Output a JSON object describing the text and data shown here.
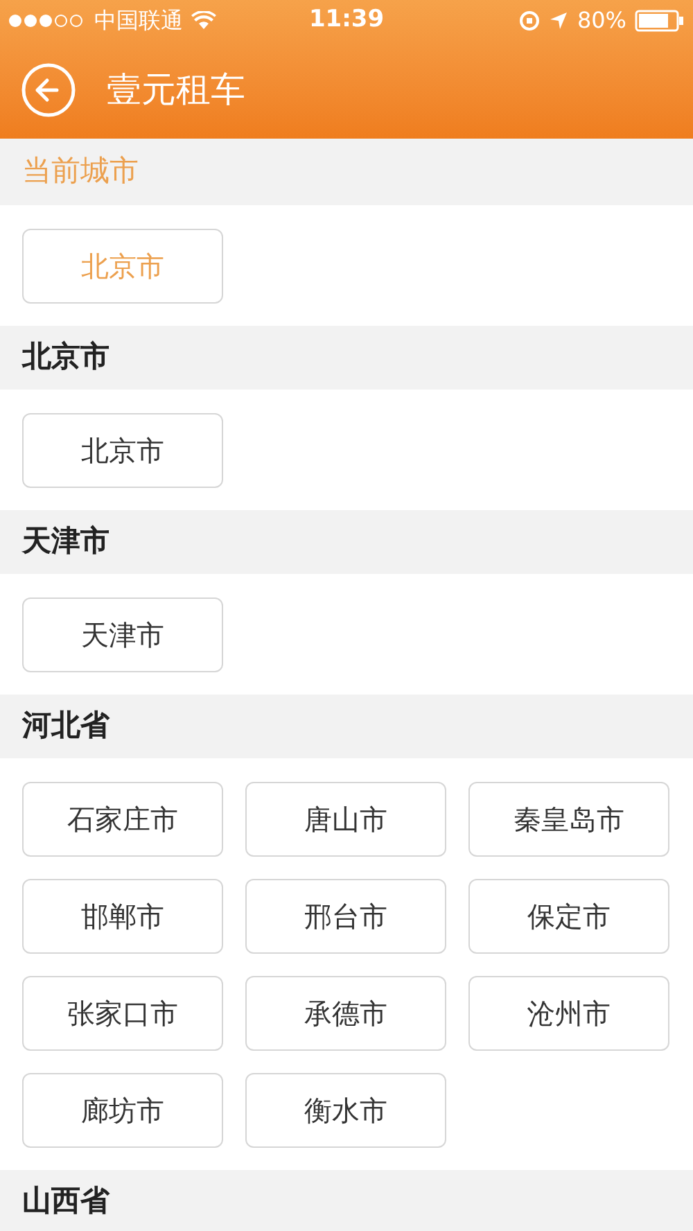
{
  "status_bar": {
    "carrier": "中国联通",
    "time": "11:39",
    "battery": "80%"
  },
  "header": {
    "title": "壹元租车"
  },
  "sections": [
    {
      "kind": "current",
      "title": "当前城市",
      "cities": [
        "北京市"
      ]
    },
    {
      "kind": "province",
      "title": "北京市",
      "cities": [
        "北京市"
      ]
    },
    {
      "kind": "province",
      "title": "天津市",
      "cities": [
        "天津市"
      ]
    },
    {
      "kind": "province",
      "title": "河北省",
      "cities": [
        "石家庄市",
        "唐山市",
        "秦皇岛市",
        "邯郸市",
        "邢台市",
        "保定市",
        "张家口市",
        "承德市",
        "沧州市",
        "廊坊市",
        "衡水市"
      ]
    },
    {
      "kind": "province",
      "title": "山西省"
    }
  ]
}
